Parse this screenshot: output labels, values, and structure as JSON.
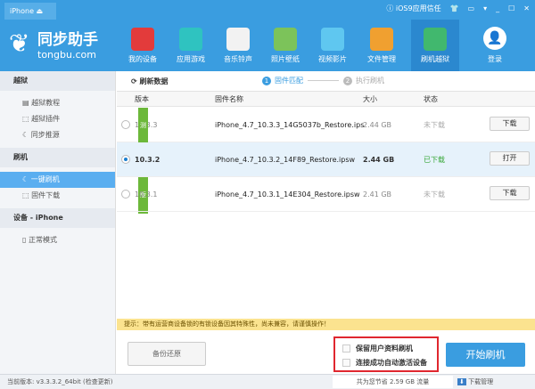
{
  "titlebar": {
    "device_tab": "iPhone",
    "ios9_trust": "iOS9应用信任"
  },
  "logo": {
    "name": "同步助手",
    "domain": "tongbu.com"
  },
  "nav": [
    {
      "label": "我的设备",
      "color": "#e33b3b"
    },
    {
      "label": "应用游戏",
      "color": "#2fc3c0"
    },
    {
      "label": "音乐铃声",
      "color": "#f2f2f2"
    },
    {
      "label": "照片壁纸",
      "color": "#7cc35a"
    },
    {
      "label": "视频影片",
      "color": "#5fc7f0"
    },
    {
      "label": "文件管理",
      "color": "#f0a030"
    },
    {
      "label": "刷机越狱",
      "color": "#41b86e"
    }
  ],
  "login": "登录",
  "sidebar": {
    "sections": [
      {
        "title": "越狱",
        "items": [
          "越狱教程",
          "越狱插件",
          "同步推源"
        ]
      },
      {
        "title": "刷机",
        "items": [
          "一键刷机",
          "固件下载"
        ]
      },
      {
        "title": "设备 - iPhone",
        "items": [
          "正常模式"
        ]
      }
    ]
  },
  "toolbar": {
    "refresh": "刷新数据",
    "step1": "固件匹配",
    "step2": "执行刷机"
  },
  "table": {
    "headers": [
      "版本",
      "固件名称",
      "大小",
      "状态"
    ],
    "rows": [
      {
        "version": "10.3.3 Beta2",
        "badge": "测试版",
        "file": "iPhone_4.7_10.3.3_14G5037b_Restore.ips",
        "size": "2.44 GB",
        "status": "未下载",
        "action": "下载",
        "selected": false
      },
      {
        "version": "10.3.2",
        "badge": "",
        "file": "iPhone_4.7_10.3.2_14F89_Restore.ipsw",
        "size": "2.44 GB",
        "status": "已下载",
        "action": "打开",
        "selected": true
      },
      {
        "version": "10.3.1",
        "badge": "",
        "file": "iPhone_4.7_10.3.1_14E304_Restore.ipsw",
        "size": "2.41 GB",
        "status": "未下载",
        "action": "下载",
        "selected": false
      }
    ]
  },
  "tip": "提示：带有运营商设备锁的有锁设备因其特殊性，尚未兼容，请谨慎操作！",
  "bottom": {
    "backup": "备份还原",
    "opt1": "保留用户资料刷机",
    "opt2": "连接成功自动激活设备",
    "start": "开始刷机"
  },
  "status": {
    "version": "当前版本: v3.3.3.2_64bit",
    "check": "(检查更新)",
    "saved": "共为您节省 2.59 GB 流量",
    "download_mgr": "下载管理"
  }
}
